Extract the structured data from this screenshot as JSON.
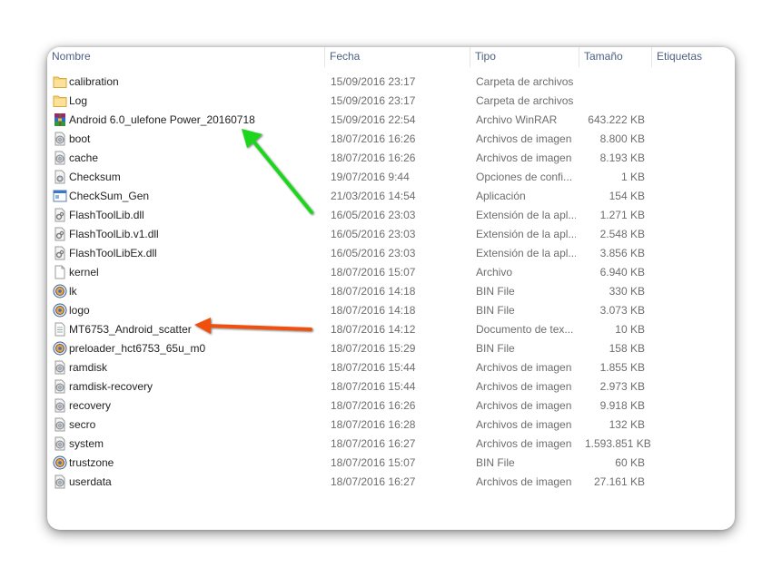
{
  "columns": {
    "name": "Nombre",
    "date": "Fecha",
    "type": "Tipo",
    "size": "Tamaño",
    "tags": "Etiquetas"
  },
  "files": [
    {
      "name": "calibration",
      "date": "15/09/2016 23:17",
      "type": "Carpeta de archivos",
      "size": "",
      "icon": "folder-icon"
    },
    {
      "name": "Log",
      "date": "15/09/2016 23:17",
      "type": "Carpeta de archivos",
      "size": "",
      "icon": "folder-icon"
    },
    {
      "name": "Android 6.0_ulefone Power_20160718",
      "date": "15/09/2016 22:54",
      "type": "Archivo WinRAR",
      "size": "643.222 KB",
      "icon": "winrar-archive-icon"
    },
    {
      "name": "boot",
      "date": "18/07/2016 16:26",
      "type": "Archivos de imagen",
      "size": "8.800 KB",
      "icon": "disk-image-icon"
    },
    {
      "name": "cache",
      "date": "18/07/2016 16:26",
      "type": "Archivos de imagen",
      "size": "8.193 KB",
      "icon": "disk-image-icon"
    },
    {
      "name": "Checksum",
      "date": "19/07/2016 9:44",
      "type": "Opciones de confi...",
      "size": "1 KB",
      "icon": "config-file-icon"
    },
    {
      "name": "CheckSum_Gen",
      "date": "21/03/2016 14:54",
      "type": "Aplicación",
      "size": "154 KB",
      "icon": "application-icon"
    },
    {
      "name": "FlashToolLib.dll",
      "date": "16/05/2016 23:03",
      "type": "Extensión de la apl...",
      "size": "1.271 KB",
      "icon": "dll-file-icon"
    },
    {
      "name": "FlashToolLib.v1.dll",
      "date": "16/05/2016 23:03",
      "type": "Extensión de la apl...",
      "size": "2.548 KB",
      "icon": "dll-file-icon"
    },
    {
      "name": "FlashToolLibEx.dll",
      "date": "16/05/2016 23:03",
      "type": "Extensión de la apl...",
      "size": "3.856 KB",
      "icon": "dll-file-icon"
    },
    {
      "name": "kernel",
      "date": "18/07/2016 15:07",
      "type": "Archivo",
      "size": "6.940 KB",
      "icon": "blank-file-icon"
    },
    {
      "name": "lk",
      "date": "18/07/2016 14:18",
      "type": "BIN File",
      "size": "330 KB",
      "icon": "bin-file-icon"
    },
    {
      "name": "logo",
      "date": "18/07/2016 14:18",
      "type": "BIN File",
      "size": "3.073 KB",
      "icon": "bin-file-icon"
    },
    {
      "name": "MT6753_Android_scatter",
      "date": "18/07/2016 14:12",
      "type": "Documento de tex...",
      "size": "10 KB",
      "icon": "text-document-icon"
    },
    {
      "name": "preloader_hct6753_65u_m0",
      "date": "18/07/2016 15:29",
      "type": "BIN File",
      "size": "158 KB",
      "icon": "bin-file-icon"
    },
    {
      "name": "ramdisk",
      "date": "18/07/2016 15:44",
      "type": "Archivos de imagen",
      "size": "1.855 KB",
      "icon": "disk-image-icon"
    },
    {
      "name": "ramdisk-recovery",
      "date": "18/07/2016 15:44",
      "type": "Archivos de imagen",
      "size": "2.973 KB",
      "icon": "disk-image-icon"
    },
    {
      "name": "recovery",
      "date": "18/07/2016 16:26",
      "type": "Archivos de imagen",
      "size": "9.918 KB",
      "icon": "disk-image-icon"
    },
    {
      "name": "secro",
      "date": "18/07/2016 16:28",
      "type": "Archivos de imagen",
      "size": "132 KB",
      "icon": "disk-image-icon"
    },
    {
      "name": "system",
      "date": "18/07/2016 16:27",
      "type": "Archivos de imagen",
      "size": "1.593.851 KB",
      "icon": "disk-image-icon"
    },
    {
      "name": "trustzone",
      "date": "18/07/2016 15:07",
      "type": "BIN File",
      "size": "60 KB",
      "icon": "bin-file-icon"
    },
    {
      "name": "userdata",
      "date": "18/07/2016 16:27",
      "type": "Archivos de imagen",
      "size": "27.161 KB",
      "icon": "disk-image-icon"
    }
  ],
  "annotations": {
    "green_arrow_color": "#1fd61f",
    "orange_arrow_color": "#f0500f"
  }
}
